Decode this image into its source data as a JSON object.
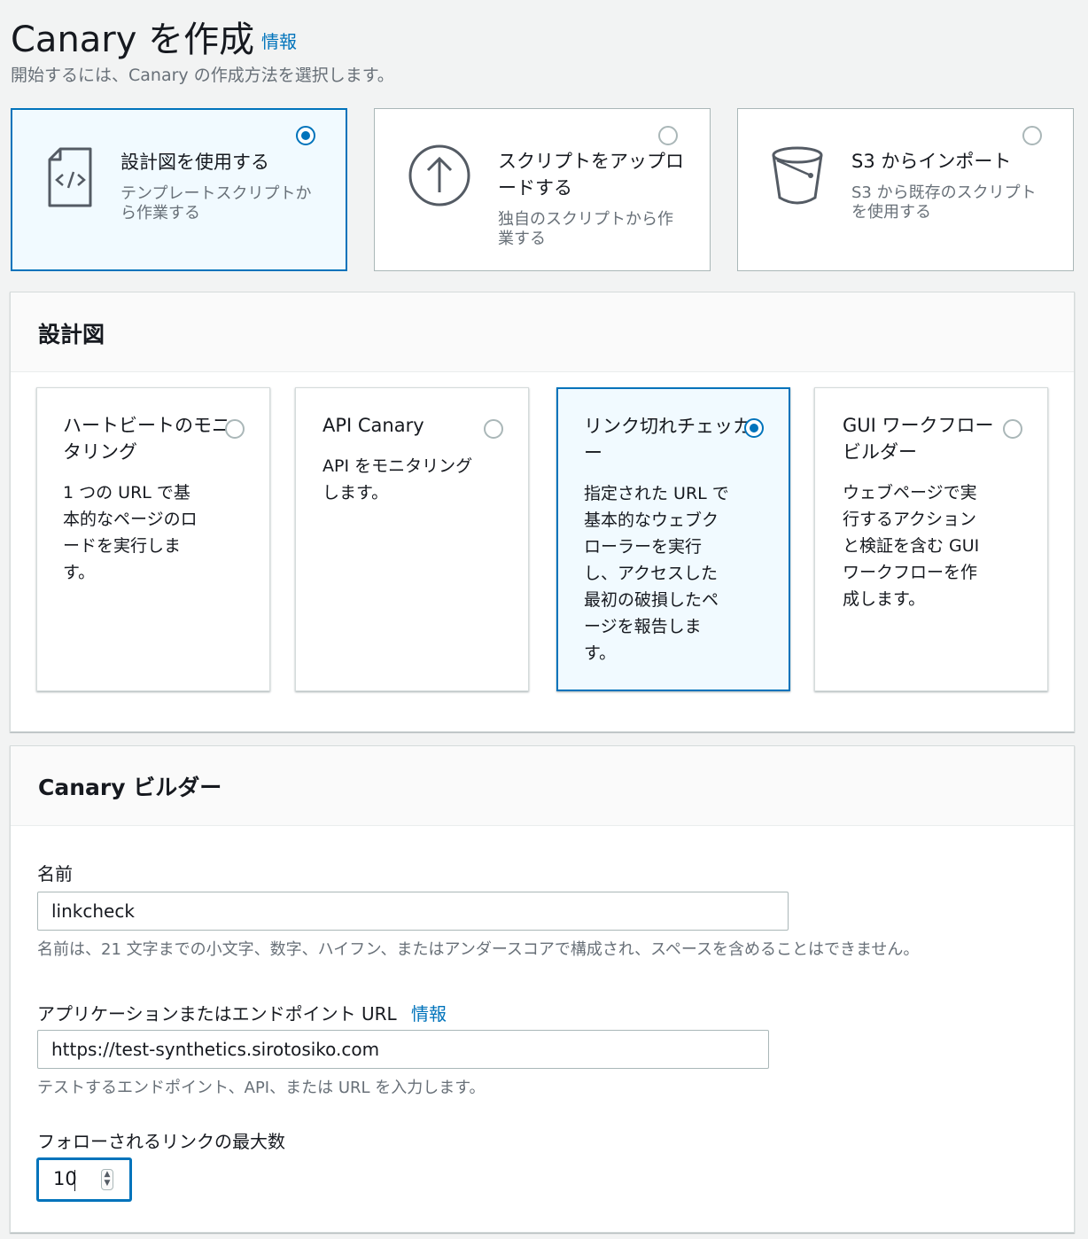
{
  "header": {
    "title": "Canary を作成",
    "info": "情報",
    "subtitle": "開始するには、Canary の作成方法を選択します。"
  },
  "methods": [
    {
      "title": "設計図を使用する",
      "desc": "テンプレートスクリプトから作業する",
      "selected": true,
      "icon": "code-file-icon"
    },
    {
      "title": "スクリプトをアップロードする",
      "desc": "独自のスクリプトから作業する",
      "selected": false,
      "icon": "upload-icon"
    },
    {
      "title": "S3 からインポート",
      "desc": "S3 から既存のスクリプトを使用する",
      "selected": false,
      "icon": "bucket-icon"
    }
  ],
  "blueprints": {
    "heading": "設計図",
    "cards": [
      {
        "title": "ハートビートのモニタリング",
        "desc": "1 つの URL で基本的なページのロードを実行します。",
        "selected": false
      },
      {
        "title": "API Canary",
        "desc": "API をモニタリングします。",
        "selected": false
      },
      {
        "title": "リンク切れチェッカー",
        "desc": "指定された URL で基本的なウェブクローラーを実行し、アクセスした最初の破損したページを報告します。",
        "selected": true
      },
      {
        "title": "GUI ワークフロービルダー",
        "desc": "ウェブページで実行するアクションと検証を含む GUI ワークフローを作成します。",
        "selected": false
      }
    ]
  },
  "builder": {
    "heading": "Canary ビルダー",
    "name_label": "名前",
    "name_value": "linkcheck",
    "name_hint": "名前は、21 文字までの小文字、数字、ハイフン、またはアンダースコアで構成され、スペースを含めることはできません。",
    "url_label": "アプリケーションまたはエンドポイント URL",
    "url_info": "情報",
    "url_value": "https://test-synthetics.sirotosiko.com",
    "url_hint": "テストするエンドポイント、API、または URL を入力します。",
    "max_links_label": "フォローされるリンクの最大数",
    "max_links_value": "10"
  },
  "colors": {
    "accent": "#0073bb",
    "selected_bg": "#f1faff",
    "muted_text": "#687078"
  }
}
